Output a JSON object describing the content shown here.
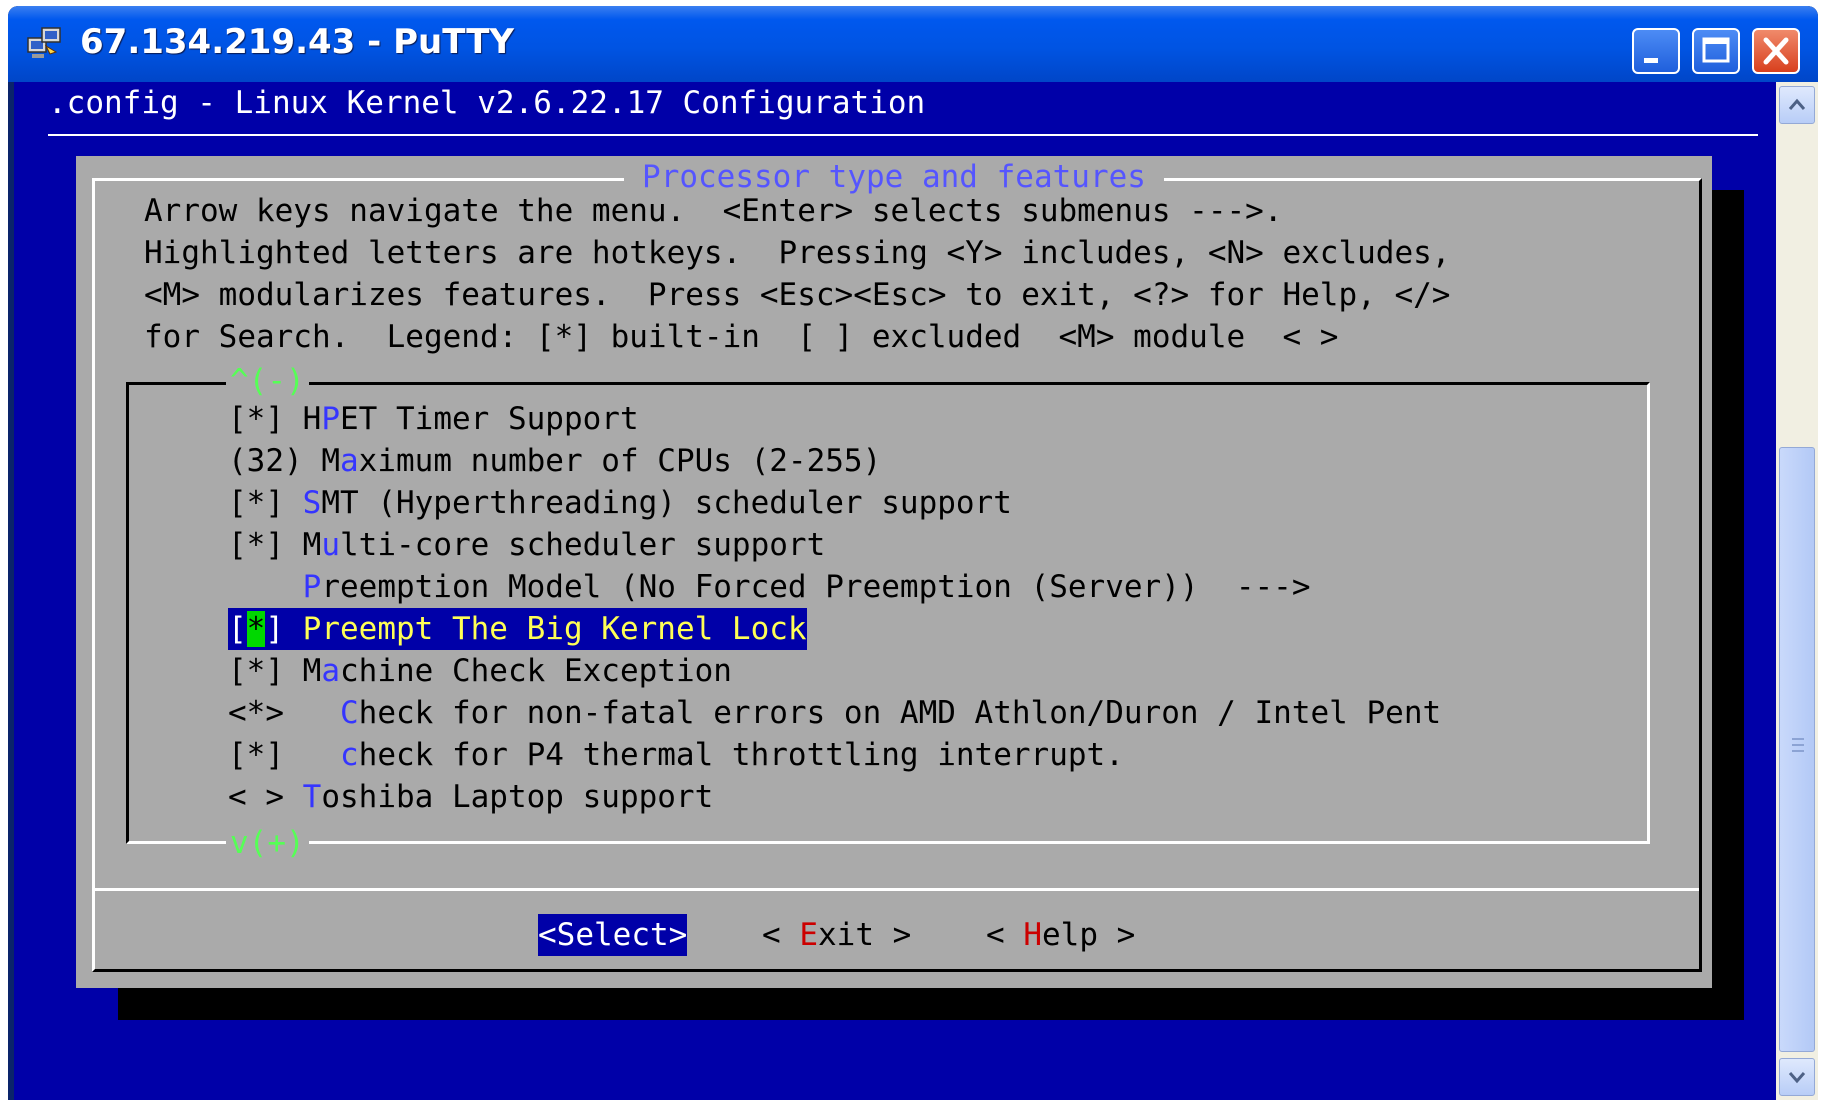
{
  "window": {
    "title": "67.134.219.43 - PuTTY",
    "icon": "putty-computers-icon"
  },
  "terminal": {
    "header_title": ".config - Linux Kernel v2.6.22.17 Configuration",
    "dialog_title": "Processor type and features",
    "help_lines": [
      "Arrow keys navigate the menu.  <Enter> selects submenus --->.",
      "Highlighted letters are hotkeys.  Pressing <Y> includes, <N> excludes,",
      "<M> modularizes features.  Press <Esc><Esc> to exit, <?> for Help, </>",
      "for Search.  Legend: [*] built-in  [ ] excluded  <M> module  < >"
    ],
    "scroll_up_indicator": "^(-)",
    "scroll_down_indicator": "v(+)",
    "menu_items": [
      {
        "prefix": "[*] ",
        "prefix_b": "",
        "lead": "H",
        "hotkey": "P",
        "rest": "ET Timer Support"
      },
      {
        "prefix": "(32) ",
        "prefix_b": "",
        "lead": "M",
        "hotkey": "a",
        "rest": "ximum number of CPUs (2-255)"
      },
      {
        "prefix": "[*] ",
        "prefix_b": "",
        "lead": "",
        "hotkey": "S",
        "rest": "MT (Hyperthreading) scheduler support"
      },
      {
        "prefix": "[*] ",
        "prefix_b": "",
        "lead": "M",
        "hotkey": "u",
        "rest": "lti-core scheduler support"
      },
      {
        "prefix": "    ",
        "prefix_b": "",
        "lead": "",
        "hotkey": "P",
        "rest": "reemption Model (No Forced Preemption (Server))  --->"
      },
      {
        "prefix": "[",
        "cursor": "*",
        "prefix_b": "] ",
        "label": "Preempt The Big Kernel Lock"
      },
      {
        "prefix": "[*] ",
        "prefix_b": "",
        "lead": "M",
        "hotkey": "a",
        "rest": "chine Check Exception"
      },
      {
        "prefix": "<*>   ",
        "prefix_b": "",
        "lead": "",
        "hotkey": "C",
        "rest": "heck for non-fatal errors on AMD Athlon/Duron / Intel Pent"
      },
      {
        "prefix": "[*]   ",
        "prefix_b": "",
        "lead": "",
        "hotkey": "c",
        "rest": "heck for P4 thermal throttling interrupt."
      },
      {
        "prefix": "< > ",
        "prefix_b": "",
        "lead": "",
        "hotkey": "T",
        "rest": "oshiba Laptop support"
      }
    ],
    "buttons": {
      "select": {
        "text": "<Select>"
      },
      "exit": {
        "pre": "< ",
        "hotkey": "E",
        "post": "xit >"
      },
      "help": {
        "pre": "< ",
        "hotkey": "H",
        "post": "elp >"
      }
    }
  },
  "colors": {
    "terminal_bg": "#0000a8",
    "dialog_bg": "#aaaaaa",
    "hotkey_menu": "#3535ff",
    "hotkey_button": "#cc0000",
    "selected_label": "#ffff55",
    "cursor": "#00d800",
    "scroll_indicator": "#55ff55"
  }
}
